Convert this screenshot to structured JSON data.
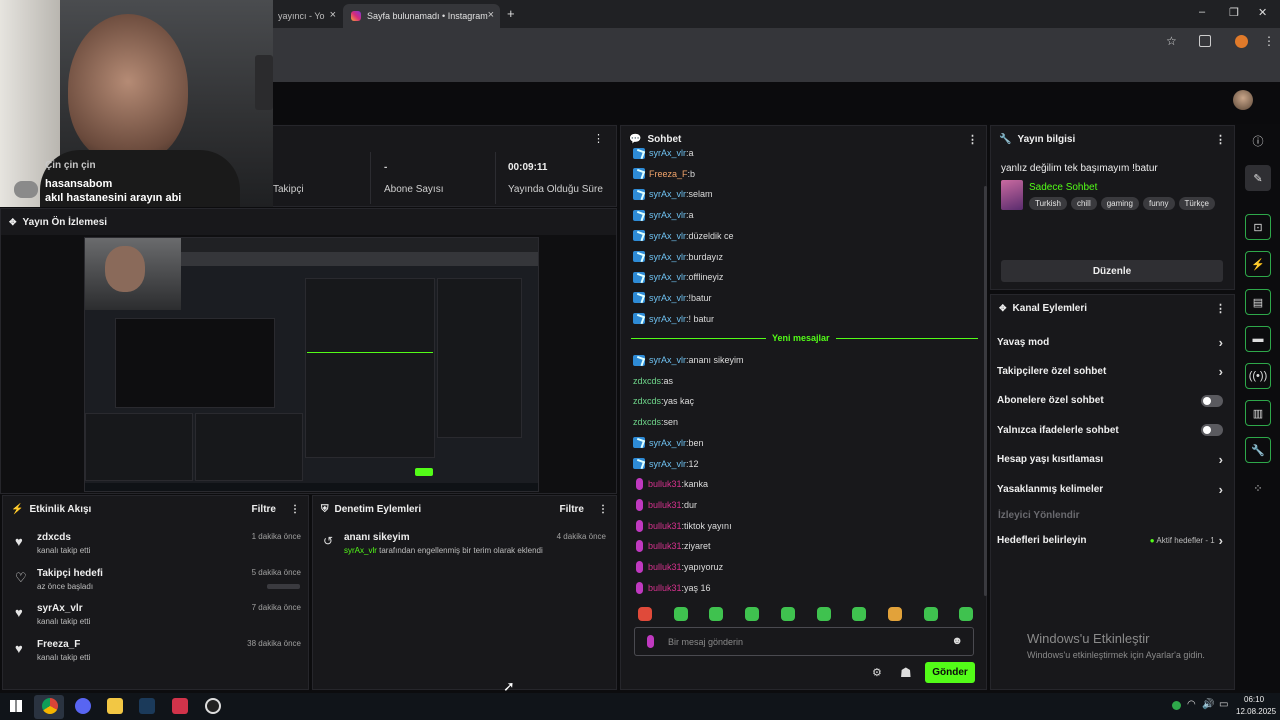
{
  "browser": {
    "tabs": [
      {
        "label": "yayıncı - Yo"
      },
      {
        "label": "Sayfa bulunamadı • Instagram"
      }
    ],
    "new_tab": "+"
  },
  "webcam": {
    "overlay_lines": [
      "Çin çin çin"
    ],
    "user": "hasansabom",
    "message": "akıl hastanesini arayın abi"
  },
  "stats": {
    "followers_label": "Takipçi",
    "subs_value": "-",
    "subs_label": "Abone Sayısı",
    "live_value": "00:09:11",
    "live_label": "Yayında Olduğu Süre"
  },
  "preview": {
    "title": "Yayın Ön İzlemesi"
  },
  "chat": {
    "title": "Sohbet",
    "new_messages_label": "Yeni mesajlar",
    "lines_before": [
      {
        "user": "syrAx_vlr",
        "text": "a",
        "color": "blue",
        "badge": "dev"
      },
      {
        "user": "Freeza_F",
        "text": "b",
        "color": "orange",
        "badge": "dev"
      },
      {
        "user": "syrAx_vlr",
        "text": "selam",
        "color": "blue",
        "badge": "dev"
      },
      {
        "user": "syrAx_vlr",
        "text": "a",
        "color": "blue",
        "badge": "dev"
      },
      {
        "user": "syrAx_vlr",
        "text": "düzeldik ce",
        "color": "blue",
        "badge": "dev"
      },
      {
        "user": "syrAx_vlr",
        "text": "burdayız",
        "color": "blue",
        "badge": "dev"
      },
      {
        "user": "syrAx_vlr",
        "text": "offlineyiz",
        "color": "blue",
        "badge": "dev"
      },
      {
        "user": "syrAx_vlr",
        "text": "!batur",
        "color": "blue",
        "badge": "dev"
      },
      {
        "user": "syrAx_vlr",
        "text": "! batur",
        "color": "blue",
        "badge": "dev"
      }
    ],
    "lines_after": [
      {
        "user": "syrAx_vlr",
        "text": "ananı sikeyim",
        "color": "blue",
        "badge": "dev"
      },
      {
        "user": "zdxcds",
        "text": "as",
        "color": "green",
        "badge": "none"
      },
      {
        "user": "zdxcds",
        "text": "yas kaç",
        "color": "green",
        "badge": "none"
      },
      {
        "user": "zdxcds",
        "text": "sen",
        "color": "green",
        "badge": "none"
      },
      {
        "user": "syrAx_vlr",
        "text": "ben",
        "color": "blue",
        "badge": "dev"
      },
      {
        "user": "syrAx_vlr",
        "text": "12",
        "color": "blue",
        "badge": "dev"
      },
      {
        "user": "bulluk31",
        "text": "kanka",
        "color": "pink",
        "badge": "mic"
      },
      {
        "user": "bulluk31",
        "text": "dur",
        "color": "pink",
        "badge": "mic"
      },
      {
        "user": "bulluk31",
        "text": "tiktok yayını",
        "color": "pink",
        "badge": "mic"
      },
      {
        "user": "bulluk31",
        "text": "ziyaret",
        "color": "pink",
        "badge": "mic"
      },
      {
        "user": "bulluk31",
        "text": "yapıyoruz",
        "color": "pink",
        "badge": "mic"
      },
      {
        "user": "bulluk31",
        "text": "yaş 16",
        "color": "pink",
        "badge": "mic"
      }
    ],
    "input_placeholder": "Bir mesaj gönderin",
    "send_label": "Gönder"
  },
  "stream_info": {
    "title": "Yayın bilgisi",
    "stream_title": "yanlız değilim tek başımayım !batur",
    "category": "Sadece Sohbet",
    "tags": [
      "Turkish",
      "chill",
      "gaming",
      "funny",
      "Türkçe"
    ],
    "edit_label": "Düzenle"
  },
  "channel_actions": {
    "title": "Kanal Eylemleri",
    "items": [
      {
        "label": "Yavaş mod",
        "control": "chevron"
      },
      {
        "label": "Takipçilere özel sohbet",
        "control": "chevron"
      },
      {
        "label": "Abonelere özel sohbet",
        "control": "toggle"
      },
      {
        "label": "Yalnızca ifadelerle sohbet",
        "control": "toggle"
      },
      {
        "label": "Hesap yaşı kısıtlaması",
        "control": "chevron"
      },
      {
        "label": "Yasaklanmış kelimeler",
        "control": "chevron"
      }
    ],
    "viewer_redirect": "İzleyici Yönlendir",
    "targets_label": "Hedefleri belirleyin",
    "targets_status": "Aktif hedefler - 1"
  },
  "activity": {
    "title": "Etkinlik Akışı",
    "filter_label": "Filtre",
    "events": [
      {
        "name": "zdxcds",
        "sub": "kanalı takip etti",
        "time": "1 dakika önce"
      },
      {
        "name": "Takipçi hedefi",
        "sub": "az önce başladı",
        "time": "5 dakika önce"
      },
      {
        "name": "syrAx_vlr",
        "sub": "kanalı takip etti",
        "time": "7 dakika önce"
      },
      {
        "name": "Freeza_F",
        "sub": "kanalı takip etti",
        "time": "38 dakika önce"
      }
    ]
  },
  "moderation": {
    "title": "Denetim Eylemleri",
    "filter_label": "Filtre",
    "entry_title": "ananı sikeyim",
    "entry_user": "syrAx_vlr",
    "entry_text": " tarafından engellenmiş bir terim olarak eklendi",
    "entry_time": "4 dakika önce"
  },
  "windows_watermark": {
    "line1": "Windows'u Etkinleştir",
    "line2": "Windows'u etkinleştirmek için Ayarlar'a gidin."
  },
  "taskbar": {
    "time": "06:10",
    "date": "12.08.2025"
  },
  "colors": {
    "accent": "#53fc18",
    "panel": "#18181b",
    "chat_blue": "#6fc2f2",
    "chat_pink": "#d6318e"
  }
}
